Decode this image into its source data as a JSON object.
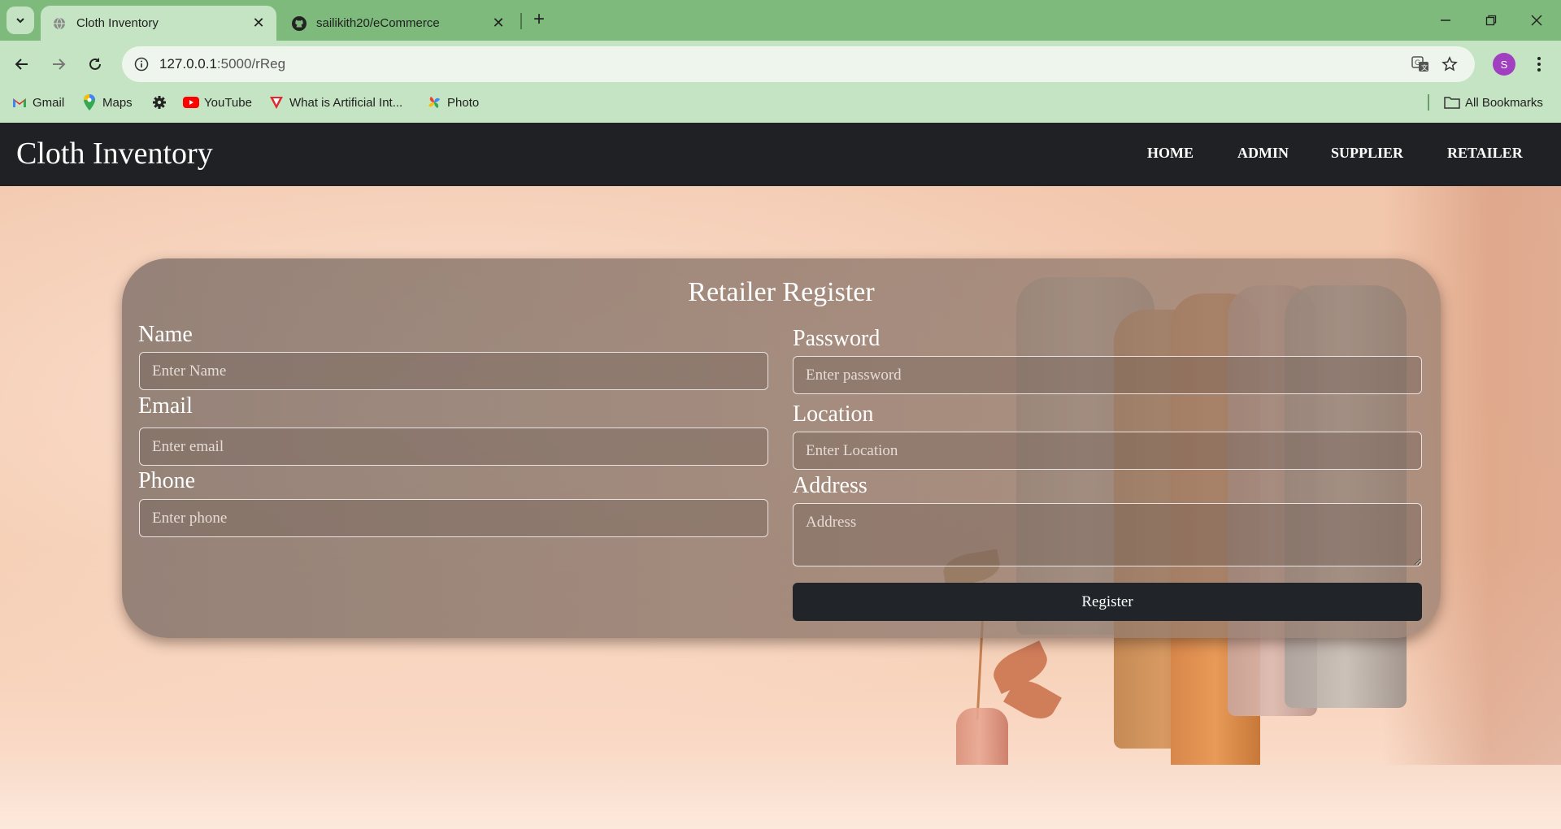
{
  "browser": {
    "tabs": [
      {
        "title": "Cloth Inventory",
        "favicon": "globe-icon",
        "active": true
      },
      {
        "title": "sailikith20/eCommerce",
        "favicon": "github-icon",
        "active": false
      }
    ],
    "url_host": "127.0.0.1",
    "url_path": ":5000/rReg",
    "profile_initial": "S",
    "bookmarks": [
      {
        "label": "Gmail",
        "icon": "gmail-icon"
      },
      {
        "label": "Maps",
        "icon": "maps-icon"
      },
      {
        "label": "",
        "icon": "gear-icon"
      },
      {
        "label": "YouTube",
        "icon": "youtube-icon"
      },
      {
        "label": "What is Artificial Int...",
        "icon": "bookmark-v-icon"
      },
      {
        "label": "Photo",
        "icon": "photos-icon"
      }
    ],
    "all_bookmarks": "All Bookmarks",
    "colors": {
      "tabbar": "#7dba7c",
      "toolbar": "#c5e4c3"
    }
  },
  "site": {
    "brand": "Cloth Inventory",
    "nav": [
      "HOME",
      "ADMIN",
      "SUPPLIER",
      "RETAILER"
    ],
    "colors": {
      "navbar": "#202124",
      "button": "#212529"
    }
  },
  "form": {
    "title": "Retailer Register",
    "name": {
      "label": "Name",
      "placeholder": "Enter Name",
      "value": ""
    },
    "email": {
      "label": "Email",
      "placeholder": "Enter email",
      "value": ""
    },
    "phone": {
      "label": "Phone",
      "placeholder": "Enter phone",
      "value": ""
    },
    "password": {
      "label": "Password",
      "placeholder": "Enter password",
      "value": ""
    },
    "location": {
      "label": "Location",
      "placeholder": "Enter Location",
      "value": ""
    },
    "address": {
      "label": "Address",
      "placeholder": "Address",
      "value": ""
    },
    "submit": "Register"
  }
}
